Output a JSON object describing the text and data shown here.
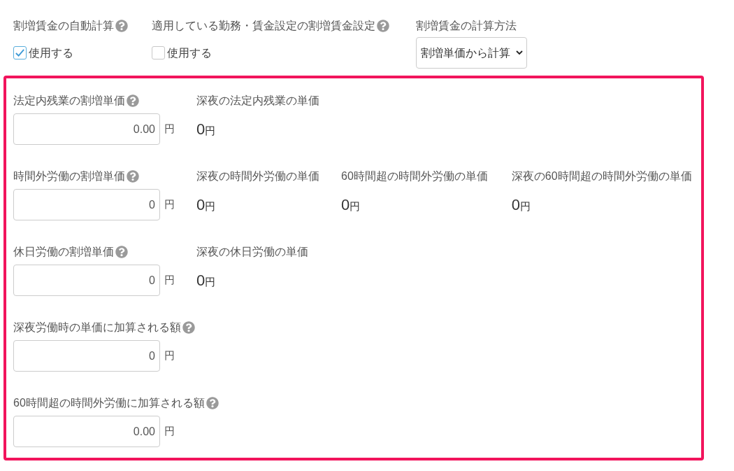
{
  "settings": [
    {
      "kind": "checkbox",
      "label": "割増賃金の自動計算",
      "help": true,
      "option": "使用する",
      "checked": true
    },
    {
      "kind": "checkbox",
      "label": "適用している勤務・賃金設定の割増賃金設定",
      "help": true,
      "option": "使用する",
      "checked": false
    },
    {
      "kind": "select",
      "label": "割増賃金の計算方法",
      "help": false,
      "value": "割増単価から計算"
    }
  ],
  "rate_panel": {
    "highlighted": true,
    "rows": [
      {
        "label": "法定内残業の割増単価",
        "help": true,
        "input": {
          "value": "0.00",
          "unit": "円"
        },
        "derived": [
          {
            "label": "深夜の法定内残業の単価",
            "value": "0",
            "unit": "円"
          }
        ]
      },
      {
        "label": "時間外労働の割増単価",
        "help": true,
        "input": {
          "value": "0",
          "unit": "円"
        },
        "derived": [
          {
            "label": "深夜の時間外労働の単価",
            "value": "0",
            "unit": "円"
          },
          {
            "label": "60時間超の時間外労働の単価",
            "value": "0",
            "unit": "円"
          },
          {
            "label": "深夜の60時間超の時間外労働の単価",
            "value": "0",
            "unit": "円"
          }
        ]
      },
      {
        "label": "休日労働の割増単価",
        "help": true,
        "input": {
          "value": "0",
          "unit": "円"
        },
        "derived": [
          {
            "label": "深夜の休日労働の単価",
            "value": "0",
            "unit": "円"
          }
        ]
      },
      {
        "label": "深夜労働時の単価に加算される額",
        "help": true,
        "input": {
          "value": "0",
          "unit": "円"
        }
      },
      {
        "label": "60時間超の時間外労働に加算される額",
        "help": true,
        "input": {
          "value": "0.00",
          "unit": "円"
        }
      }
    ]
  }
}
